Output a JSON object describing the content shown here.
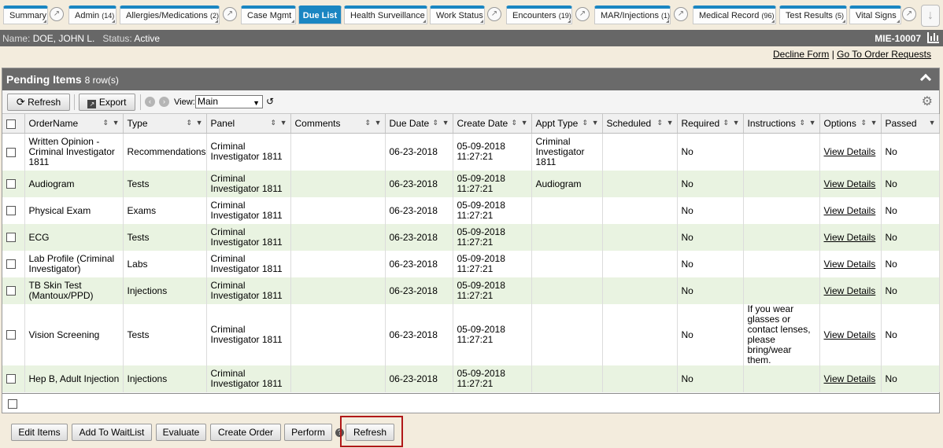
{
  "tabs": [
    {
      "label": "Summary",
      "count": ""
    },
    {
      "label": "Admin",
      "count": "(14)"
    },
    {
      "label": "Allergies/Medications",
      "count": "(2)"
    },
    {
      "label": "Case Mgmt",
      "count": ""
    },
    {
      "label": "Due List",
      "count": ""
    },
    {
      "label": "Health Surveillance",
      "count": ""
    },
    {
      "label": "Work Status",
      "count": ""
    },
    {
      "label": "Encounters",
      "count": "(19)"
    },
    {
      "label": "MAR/Injections",
      "count": "(1)"
    },
    {
      "label": "Medical Record",
      "count": "(96)"
    },
    {
      "label": "Test Results",
      "count": "(5)"
    },
    {
      "label": "Vital Signs",
      "count": ""
    }
  ],
  "active_tab": "Due List",
  "patient": {
    "name_label": "Name:",
    "name": "DOE, JOHN L.",
    "status_label": "Status:",
    "status": "Active",
    "mrn": "MIE-10007"
  },
  "links": {
    "decline_form": "Decline Form",
    "separator": "|",
    "order_requests": "Go To Order Requests"
  },
  "panel": {
    "title": "Pending Items",
    "row_count": "8 row(s)"
  },
  "toolbar": {
    "refresh": "Refresh",
    "export": "Export",
    "view_label": "View:",
    "view_value": "Main"
  },
  "columns": [
    "OrderName",
    "Type",
    "Panel",
    "Comments",
    "Due Date",
    "Create Date",
    "Appt Type",
    "Scheduled",
    "Required",
    "Instructions",
    "Options",
    "Passed"
  ],
  "rows": [
    {
      "order": "Written Opinion - Criminal Investigator 1811",
      "type": "Recommendations",
      "panel": "Criminal Investigator 1811",
      "comments": "",
      "due": "06-23-2018",
      "created": "05-09-2018 11:27:21",
      "appt": "Criminal Investigator 1811",
      "scheduled": "",
      "required": "No",
      "instructions": "",
      "options": "View Details",
      "passed": "No"
    },
    {
      "order": "Audiogram",
      "type": "Tests",
      "panel": "Criminal Investigator 1811",
      "comments": "",
      "due": "06-23-2018",
      "created": "05-09-2018 11:27:21",
      "appt": "Audiogram",
      "scheduled": "",
      "required": "No",
      "instructions": "",
      "options": "View Details",
      "passed": "No"
    },
    {
      "order": "Physical Exam",
      "type": "Exams",
      "panel": "Criminal Investigator 1811",
      "comments": "",
      "due": "06-23-2018",
      "created": "05-09-2018 11:27:21",
      "appt": "",
      "scheduled": "",
      "required": "No",
      "instructions": "",
      "options": "View Details",
      "passed": "No"
    },
    {
      "order": "ECG",
      "type": "Tests",
      "panel": "Criminal Investigator 1811",
      "comments": "",
      "due": "06-23-2018",
      "created": "05-09-2018 11:27:21",
      "appt": "",
      "scheduled": "",
      "required": "No",
      "instructions": "",
      "options": "View Details",
      "passed": "No"
    },
    {
      "order": "Lab Profile (Criminal Investigator)",
      "type": "Labs",
      "panel": "Criminal Investigator 1811",
      "comments": "",
      "due": "06-23-2018",
      "created": "05-09-2018 11:27:21",
      "appt": "",
      "scheduled": "",
      "required": "No",
      "instructions": "",
      "options": "View Details",
      "passed": "No"
    },
    {
      "order": "TB Skin Test (Mantoux/PPD)",
      "type": "Injections",
      "panel": "Criminal Investigator 1811",
      "comments": "",
      "due": "06-23-2018",
      "created": "05-09-2018 11:27:21",
      "appt": "",
      "scheduled": "",
      "required": "No",
      "instructions": "",
      "options": "View Details",
      "passed": "No"
    },
    {
      "order": "Vision Screening",
      "type": "Tests",
      "panel": "Criminal Investigator 1811",
      "comments": "",
      "due": "06-23-2018",
      "created": "05-09-2018 11:27:21",
      "appt": "",
      "scheduled": "",
      "required": "No",
      "instructions": "If you wear glasses or contact lenses, please bring/wear them.",
      "options": "View Details",
      "passed": "No"
    },
    {
      "order": "Hep B, Adult Injection",
      "type": "Injections",
      "panel": "Criminal Investigator 1811",
      "comments": "",
      "due": "06-23-2018",
      "created": "05-09-2018 11:27:21",
      "appt": "",
      "scheduled": "",
      "required": "No",
      "instructions": "",
      "options": "View Details",
      "passed": "No"
    }
  ],
  "bottom_buttons": {
    "edit_items": "Edit Items",
    "add_waitlist": "Add To WaitList",
    "evaluate": "Evaluate",
    "create_order": "Create Order",
    "perform": "Perform",
    "refresh": "Refresh"
  },
  "colors": {
    "tab_accent": "#1a86c2",
    "header_bar": "#6a6a6a",
    "alt_row": "#e9f3e1",
    "highlight": "#b01818",
    "background": "#f3ecdd"
  }
}
